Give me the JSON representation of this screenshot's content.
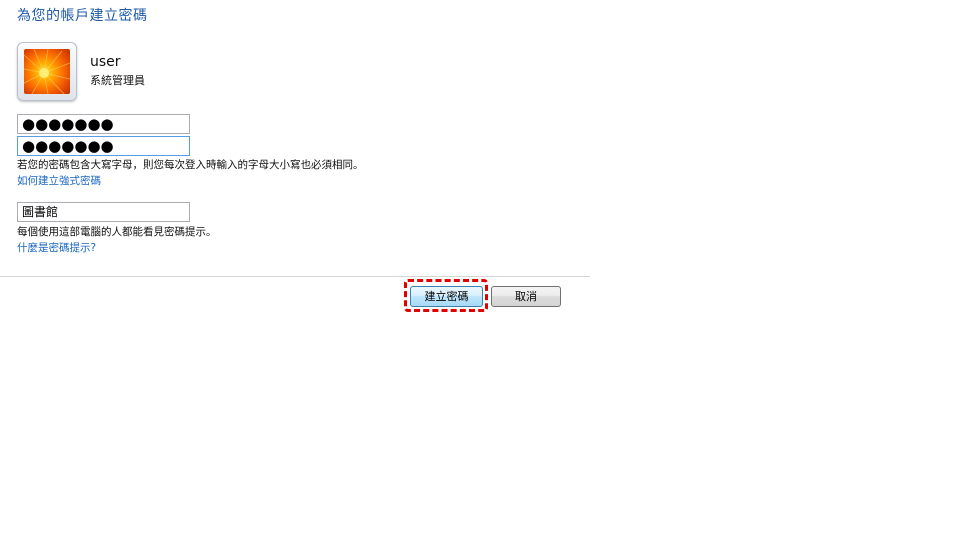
{
  "page": {
    "title": "為您的帳戶建立密碼"
  },
  "user": {
    "name": "user",
    "role": "系統管理員",
    "avatar_icon": "flower-avatar-icon"
  },
  "form": {
    "new_password_value": "●●●●●●●",
    "confirm_password_value": "●●●●●●●",
    "case_note": "若您的密碼包含大寫字母，則您每次登入時輸入的字母大小寫也必須相同。",
    "strong_password_link": "如何建立強式密碼",
    "hint_value": "圖書館",
    "hint_note": "每個使用這部電腦的人都能看見密碼提示。",
    "hint_link": "什麼是密碼提示?"
  },
  "buttons": {
    "create_label": "建立密碼",
    "cancel_label": "取消"
  },
  "colors": {
    "title": "#1e5aa8",
    "link": "#1a66c2",
    "highlight": "#e00000"
  }
}
